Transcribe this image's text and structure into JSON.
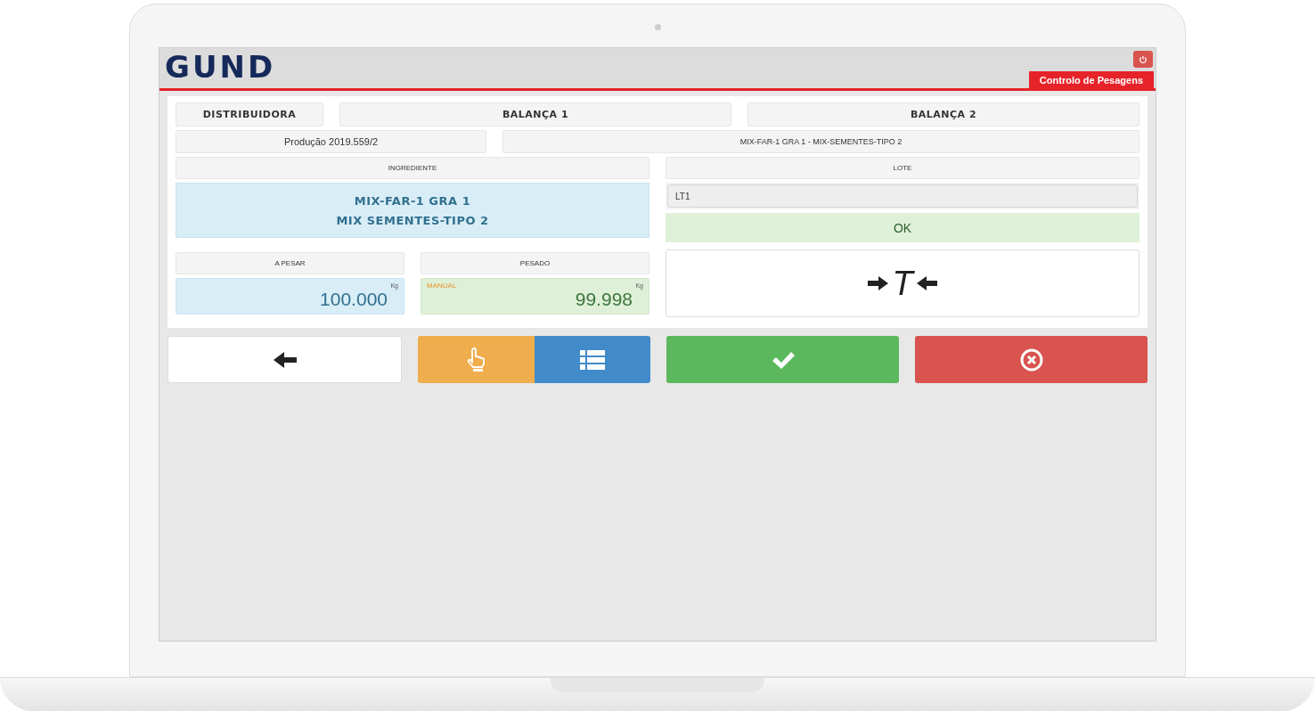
{
  "header": {
    "logo": "GUND",
    "section_tab": "Controlo de Pesagens"
  },
  "top_row": [
    {
      "label": "DISTRIBUIDORA",
      "kind": "narrow"
    },
    {
      "label": "BALANÇA 1",
      "kind": "wide"
    },
    {
      "label": "BALANÇA 2",
      "kind": "wide"
    }
  ],
  "order_row": {
    "production": "Produção 2019.559/2",
    "recipe": "MIX-FAR-1 GRA 1 - MIX-SEMENTES-TIPO 2"
  },
  "ingredient": {
    "label": "INGREDIENTE",
    "lines": [
      "MIX-FAR-1 GRA 1",
      "MIX SEMENTES-TIPO 2"
    ]
  },
  "lot": {
    "label": "LOTE",
    "value": "LT1",
    "status": "OK"
  },
  "to_weigh": {
    "label": "A PESAR",
    "unit": "Kg",
    "value": "100.000"
  },
  "weighed": {
    "label": "PESADO",
    "mode": "MANUAL",
    "unit": "Kg",
    "value": "99.998"
  },
  "tare_button": {
    "label": "T"
  },
  "actions": [
    {
      "kind": "back"
    },
    {
      "kind": "manual"
    },
    {
      "kind": "list"
    },
    {
      "kind": "confirm"
    },
    {
      "kind": "cancel"
    }
  ]
}
